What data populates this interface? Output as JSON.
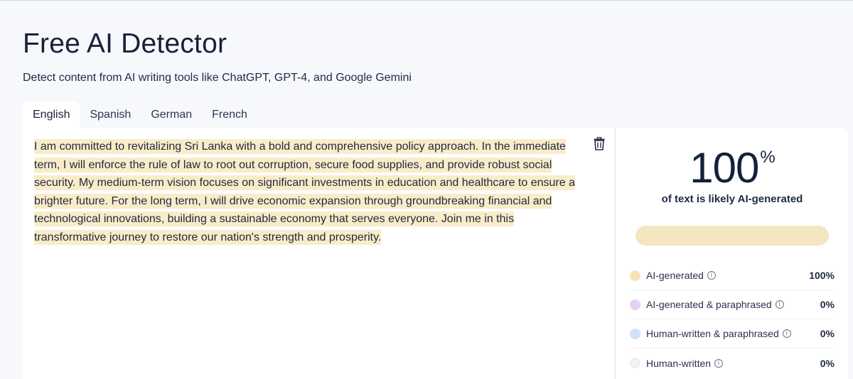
{
  "header": {
    "title": "Free AI Detector",
    "subtitle": "Detect content from AI writing tools like ChatGPT, GPT-4, and Google Gemini"
  },
  "tabs": [
    {
      "label": "English",
      "active": true
    },
    {
      "label": "Spanish",
      "active": false
    },
    {
      "label": "German",
      "active": false
    },
    {
      "label": "French",
      "active": false
    }
  ],
  "editor": {
    "text": "I am committed to revitalizing Sri Lanka with a bold and comprehensive policy approach. In the immediate term, I will enforce the rule of law to root out corruption, secure food supplies, and provide robust social security. My medium-term vision focuses on significant investments in education and healthcare to ensure a brighter future. For the long term, I will drive economic expansion through groundbreaking financial and technological innovations, building a sustainable economy that serves everyone. Join me in this transformative journey to restore our nation's strength and prosperity.",
    "highlight_color": "#faecc9",
    "delete_icon": "trash-icon"
  },
  "result": {
    "score": "100",
    "score_unit": "%",
    "caption": "of text is likely AI-generated",
    "bar_fill_fraction": 1.0,
    "bar_color": "#f4e6c1",
    "legend": [
      {
        "label": "AI-generated",
        "value": "100%",
        "color": "#f6e3b8"
      },
      {
        "label": "AI-generated & paraphrased",
        "value": "0%",
        "color": "#e3d2f3"
      },
      {
        "label": "Human-written & paraphrased",
        "value": "0%",
        "color": "#cfe0f7"
      },
      {
        "label": "Human-written",
        "value": "0%",
        "color": "#f1f2f4"
      }
    ],
    "info_icon": "info-icon"
  }
}
